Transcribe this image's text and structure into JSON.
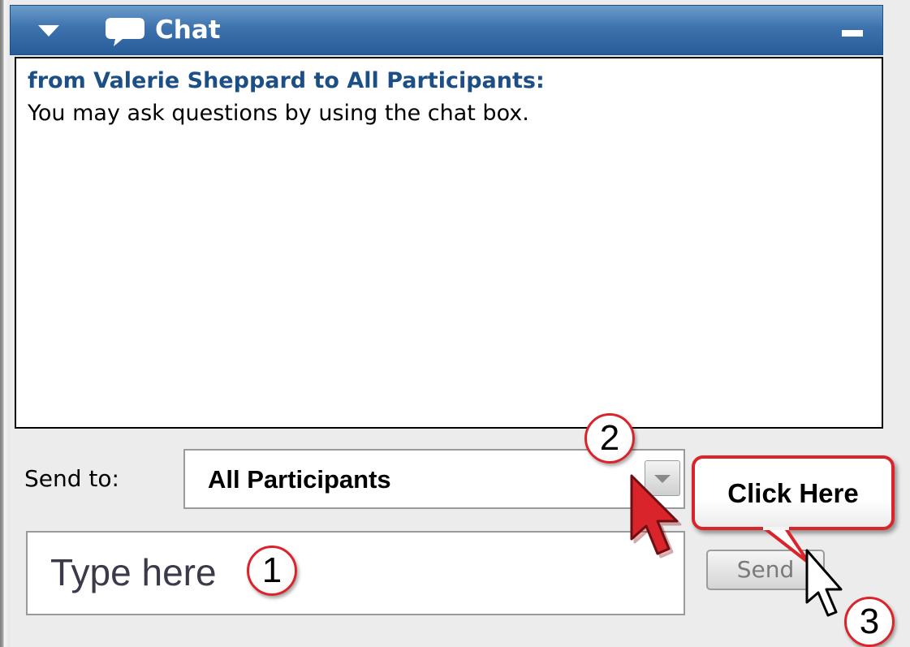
{
  "window": {
    "title": "Chat"
  },
  "transcript": {
    "messages": [
      {
        "from": "from Valerie Sheppard to All Participants:",
        "text": "You may ask questions by using the chat box."
      }
    ]
  },
  "composer": {
    "send_to_label": "Send to:",
    "recipient_selected": "All Participants",
    "input_placeholder": "Type here",
    "send_label": "Send"
  },
  "annotations": {
    "steps": [
      "1",
      "2",
      "3"
    ],
    "callout": "Click Here"
  },
  "icons": {
    "collapse": "triangle-down-icon",
    "chat": "speech-bubble-icon",
    "minimize": "minimize-icon",
    "dropdown": "chevron-down-icon",
    "cursor_red": "red-arrow-cursor-icon",
    "cursor_white": "white-arrow-cursor-icon"
  },
  "colors": {
    "titlebar": "#3d72ad",
    "sender_text": "#1c4f86",
    "annotation_red": "#d8242a"
  }
}
